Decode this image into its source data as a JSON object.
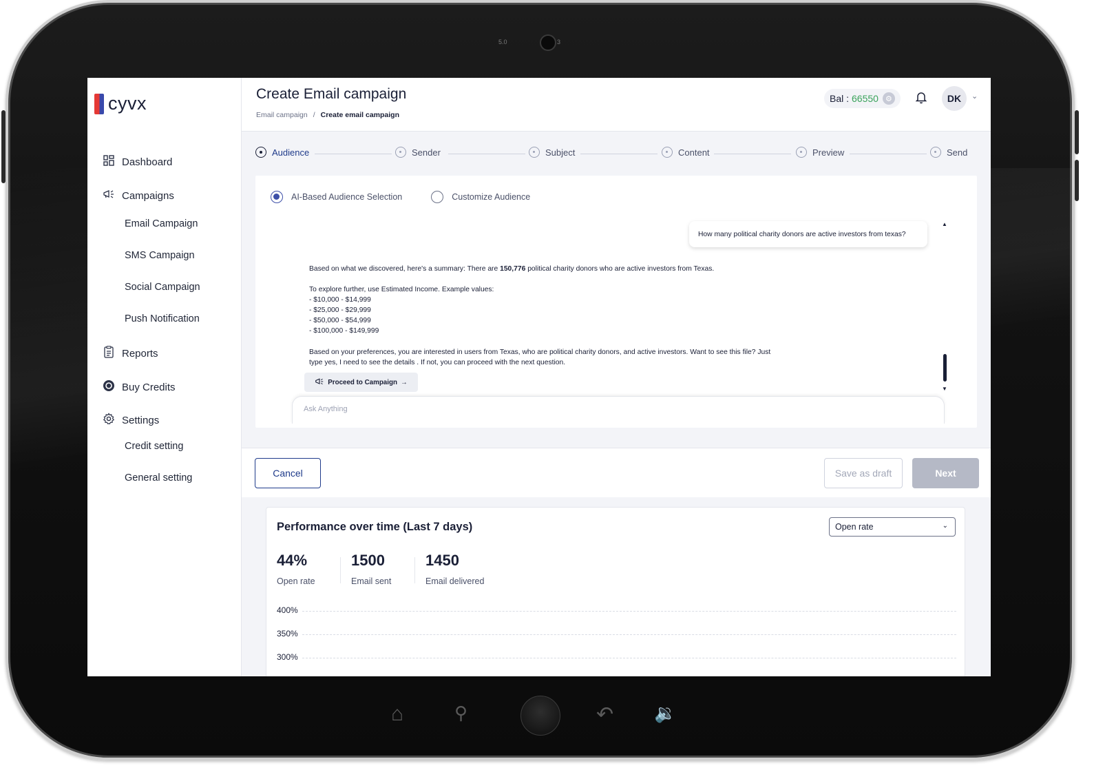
{
  "device": {
    "camera_left_label": "5.0",
    "camera_right_label": "3"
  },
  "brand": {
    "name": "cyvx"
  },
  "sidebar": {
    "items": [
      {
        "label": "Dashboard",
        "icon": "grid-icon"
      },
      {
        "label": "Campaigns",
        "icon": "megaphone-icon"
      },
      {
        "label": "Email Campaign"
      },
      {
        "label": "SMS Campaign"
      },
      {
        "label": "Social Campaign"
      },
      {
        "label": "Push Notification"
      },
      {
        "label": "Reports",
        "icon": "clipboard-icon"
      },
      {
        "label": "Buy Credits",
        "icon": "coin-icon"
      },
      {
        "label": "Settings",
        "icon": "gear-icon"
      },
      {
        "label": "Credit setting"
      },
      {
        "label": "General setting"
      }
    ]
  },
  "header": {
    "title": "Create Email campaign",
    "breadcrumb": {
      "parent": "Email campaign",
      "separator": "/",
      "current": "Create email campaign"
    },
    "balance_label": "Bal :",
    "balance_value": "66550",
    "avatar_initials": "DK"
  },
  "stepper": {
    "steps": [
      "Audience",
      "Sender",
      "Subject",
      "Content",
      "Preview",
      "Send"
    ],
    "active_index": 0
  },
  "audience": {
    "options": [
      "AI-Based Audience Selection",
      "Customize Audience"
    ],
    "selected_index": 0,
    "user_message": "How many political charity donors are active investors from texas?",
    "answer": {
      "summary_prefix": "Based on what we discovered, here's a summary: There are",
      "summary_count": "150,776",
      "summary_suffix": "political charity donors who are active investors from Texas.",
      "explore_line": "To explore further, use Estimated Income. Example values:",
      "values": [
        "- $10,000 - $14,999",
        "- $25,000 - $29,999",
        "- $50,000 - $54,999",
        "- $100,000 - $149,999"
      ],
      "preferences_line1": "Based on your preferences, you are interested in users from Texas, who are political charity donors, and active investors. Want to see this file? Just",
      "preferences_line2": "type yes, I need to see the details . If not, you can proceed with the next question."
    },
    "proceed_button": "Proceed to Campaign",
    "ask_placeholder": "Ask Anything"
  },
  "footer": {
    "cancel": "Cancel",
    "save_draft": "Save as draft",
    "next": "Next"
  },
  "performance": {
    "title": "Performance over time (Last 7 days)",
    "metric_select": "Open rate",
    "stats": [
      {
        "value": "44%",
        "label": "Open rate"
      },
      {
        "value": "1500",
        "label": "Email sent"
      },
      {
        "value": "1450",
        "label": "Email delivered"
      }
    ],
    "y_ticks": [
      "400%",
      "350%",
      "300%"
    ]
  },
  "colors": {
    "primary": "#1e3a8a",
    "balance": "#3aa35b",
    "radio_active": "#3d4fa8",
    "next_disabled": "#b5b9c6"
  }
}
